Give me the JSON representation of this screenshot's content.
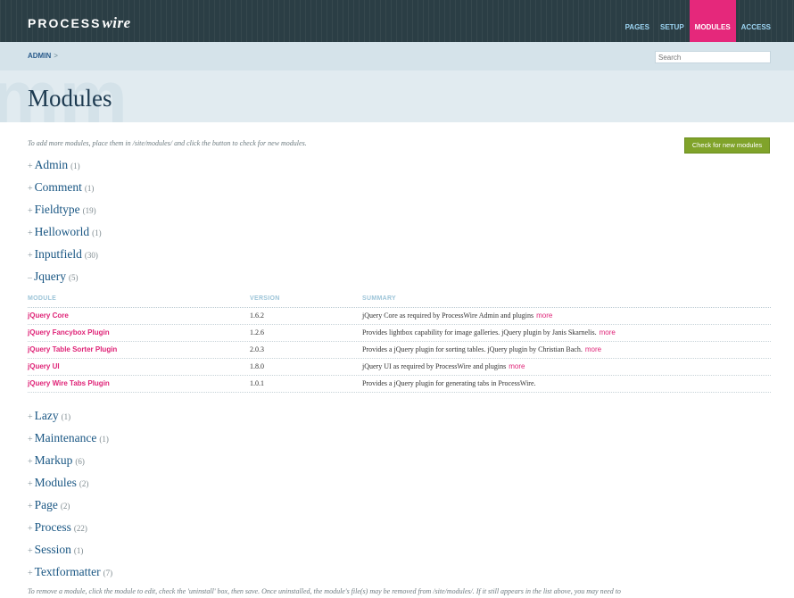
{
  "header": {
    "logo_main": "PROCESS",
    "logo_accent": "wire",
    "nav": [
      "PAGES",
      "SETUP",
      "MODULES",
      "ACCESS"
    ],
    "active_nav": "MODULES"
  },
  "breadcrumb": {
    "item": "ADMIN",
    "sep": ">"
  },
  "search": {
    "placeholder": "Search"
  },
  "page": {
    "ghost_text": "mm",
    "title": "Modules"
  },
  "intro_text": "To add more modules, place them in /site/modules/ and click the button to check for new modules.",
  "check_button_label": "Check for new modules",
  "groups_before": [
    {
      "toggle": "+",
      "name": "Admin",
      "count": "(1)"
    },
    {
      "toggle": "+",
      "name": "Comment",
      "count": "(1)"
    },
    {
      "toggle": "+",
      "name": "Fieldtype",
      "count": "(19)"
    },
    {
      "toggle": "+",
      "name": "Helloworld",
      "count": "(1)"
    },
    {
      "toggle": "+",
      "name": "Inputfield",
      "count": "(30)"
    },
    {
      "toggle": "–",
      "name": "Jquery",
      "count": "(5)"
    }
  ],
  "table": {
    "headers": [
      "MODULE",
      "VERSION",
      "SUMMARY"
    ],
    "rows": [
      {
        "name": "jQuery Core",
        "version": "1.6.2",
        "summary": "jQuery Core as required by ProcessWire Admin and plugins",
        "more": "more"
      },
      {
        "name": "jQuery Fancybox Plugin",
        "version": "1.2.6",
        "summary": "Provides lightbox capability for image galleries. jQuery plugin by Janis Skarnelis.",
        "more": "more"
      },
      {
        "name": "jQuery Table Sorter Plugin",
        "version": "2.0.3",
        "summary": "Provides a jQuery plugin for sorting tables. jQuery plugin by Christian Bach.",
        "more": "more"
      },
      {
        "name": "jQuery UI",
        "version": "1.8.0",
        "summary": "jQuery UI as required by ProcessWire and plugins",
        "more": "more"
      },
      {
        "name": "jQuery Wire Tabs Plugin",
        "version": "1.0.1",
        "summary": "Provides a jQuery plugin for generating tabs in ProcessWire.",
        "more": ""
      }
    ]
  },
  "groups_after": [
    {
      "toggle": "+",
      "name": "Lazy",
      "count": "(1)"
    },
    {
      "toggle": "+",
      "name": "Maintenance",
      "count": "(1)"
    },
    {
      "toggle": "+",
      "name": "Markup",
      "count": "(6)"
    },
    {
      "toggle": "+",
      "name": "Modules",
      "count": "(2)"
    },
    {
      "toggle": "+",
      "name": "Page",
      "count": "(2)"
    },
    {
      "toggle": "+",
      "name": "Process",
      "count": "(22)"
    },
    {
      "toggle": "+",
      "name": "Session",
      "count": "(1)"
    },
    {
      "toggle": "+",
      "name": "Textformatter",
      "count": "(7)"
    }
  ],
  "footer_note": "To remove a module, click the module to edit, check the 'uninstall' box, then save. Once uninstalled, the module's file(s) may be removed from /site/modules/. If it still appears in the list above, you may need to",
  "colors": {
    "header_bg": "#2b3e45",
    "accent_pink": "#e5287b",
    "button_green": "#80a32a",
    "link_blue": "#195683"
  }
}
